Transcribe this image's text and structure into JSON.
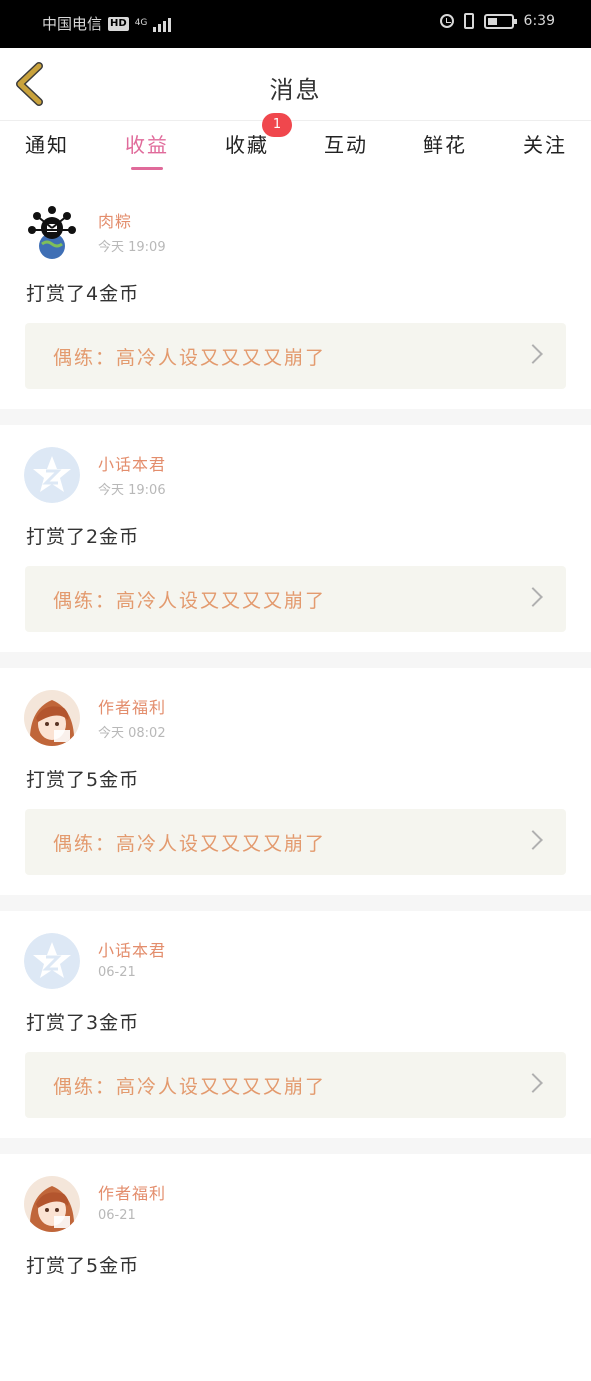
{
  "status_bar": {
    "carrier": "中国电信",
    "hd": "HD",
    "network": "4G",
    "time": "6:39"
  },
  "header": {
    "title": "消息"
  },
  "tabs": [
    {
      "label": "通知",
      "active": false
    },
    {
      "label": "收益",
      "active": true
    },
    {
      "label": "收藏",
      "active": false,
      "badge": "1"
    },
    {
      "label": "互动",
      "active": false
    },
    {
      "label": "鲜花",
      "active": false
    },
    {
      "label": "关注",
      "active": false
    }
  ],
  "messages": [
    {
      "user": "肉粽",
      "time": "今天 19:09",
      "avatar": "pattern-avatar",
      "reward": "打赏了4金币",
      "work": "偶练：高冷人设又又又又崩了"
    },
    {
      "user": "小话本君",
      "time": "今天 19:06",
      "avatar": "default-avatar",
      "reward": "打赏了2金币",
      "work": "偶练：高冷人设又又又又崩了"
    },
    {
      "user": "作者福利",
      "time": "今天 08:02",
      "avatar": "anime-avatar",
      "reward": "打赏了5金币",
      "work": "偶练：高冷人设又又又又崩了"
    },
    {
      "user": "小话本君",
      "time": "06-21",
      "avatar": "default-avatar",
      "reward": "打赏了3金币",
      "work": "偶练：高冷人设又又又又崩了"
    },
    {
      "user": "作者福利",
      "time": "06-21",
      "avatar": "anime-avatar",
      "reward": "打赏了5金币",
      "work": ""
    }
  ],
  "colors": {
    "accent": "#e06a9a",
    "username": "#e38d6c",
    "work_title": "#e39a6e",
    "badge": "#f0474d",
    "card_link_bg": "#f5f5ef",
    "back_arrow": "#c9a23c"
  }
}
